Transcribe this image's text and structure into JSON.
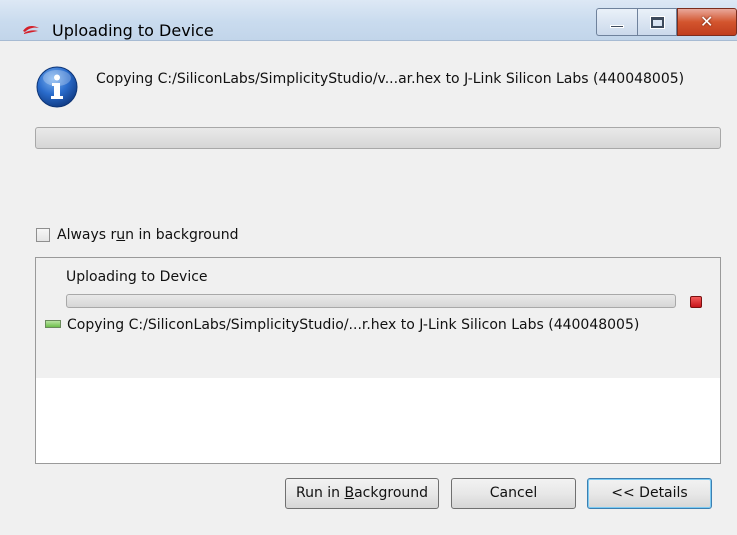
{
  "window": {
    "title": "Uploading to Device"
  },
  "message": {
    "text": "Copying C:/SiliconLabs/SimplicityStudio/v...ar.hex to J-Link Silicon Labs (440048005)",
    "main_progress": 0
  },
  "checkbox": {
    "label_pre": "Always r",
    "label_mnemonic": "u",
    "label_post": "n in background",
    "checked": false
  },
  "details": {
    "job_title": "Uploading to Device",
    "job_progress": 0,
    "task_text": "Copying C:/SiliconLabs/SimplicityStudio/...r.hex to J-Link Silicon Labs (440048005)"
  },
  "buttons": {
    "run_pre": "Run in ",
    "run_mnemonic": "B",
    "run_post": "ackground",
    "cancel": "Cancel",
    "details": "<< Details"
  },
  "colors": {
    "progress_green": "#06b025",
    "stop_red": "#d91d1d",
    "info_blue": "#1f5fb8"
  },
  "icons": {
    "app": "simplicity-studio-icon",
    "info": "info-icon",
    "stop": "stop-icon",
    "task": "task-icon"
  }
}
